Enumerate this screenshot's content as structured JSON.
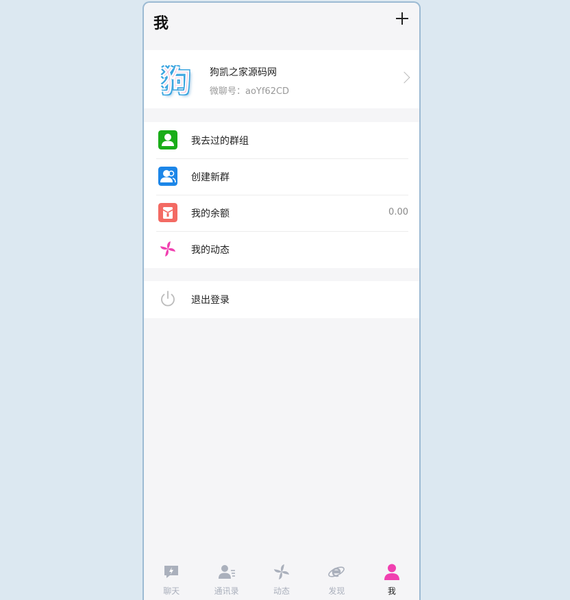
{
  "header": {
    "title": "我"
  },
  "profile": {
    "avatar_text": "狗",
    "name": "狗凯之家源码网",
    "id_text": "微聊号：aoYf62CD"
  },
  "menu": {
    "items": [
      {
        "label": "我去过的群组",
        "icon": "group-visited-icon",
        "color": "#1aad19",
        "value": ""
      },
      {
        "label": "创建新群",
        "icon": "create-group-icon",
        "color": "#1c86e8",
        "value": ""
      },
      {
        "label": "我的余额",
        "icon": "wallet-icon",
        "color": "#f36a63",
        "value": "0.00"
      },
      {
        "label": "我的动态",
        "icon": "pinwheel-icon",
        "color": "#f040b0",
        "value": ""
      }
    ],
    "logout": {
      "label": "退出登录",
      "icon": "power-icon"
    }
  },
  "tabbar": {
    "tabs": [
      {
        "label": "聊天",
        "icon": "chat-icon"
      },
      {
        "label": "通讯录",
        "icon": "contacts-icon"
      },
      {
        "label": "动态",
        "icon": "pinwheel-icon"
      },
      {
        "label": "发现",
        "icon": "discover-icon"
      },
      {
        "label": "我",
        "icon": "me-icon",
        "active": true
      }
    ]
  },
  "colors": {
    "accent": "#f040b0",
    "inactive": "#aab0bc",
    "background": "#f5f5f7"
  }
}
